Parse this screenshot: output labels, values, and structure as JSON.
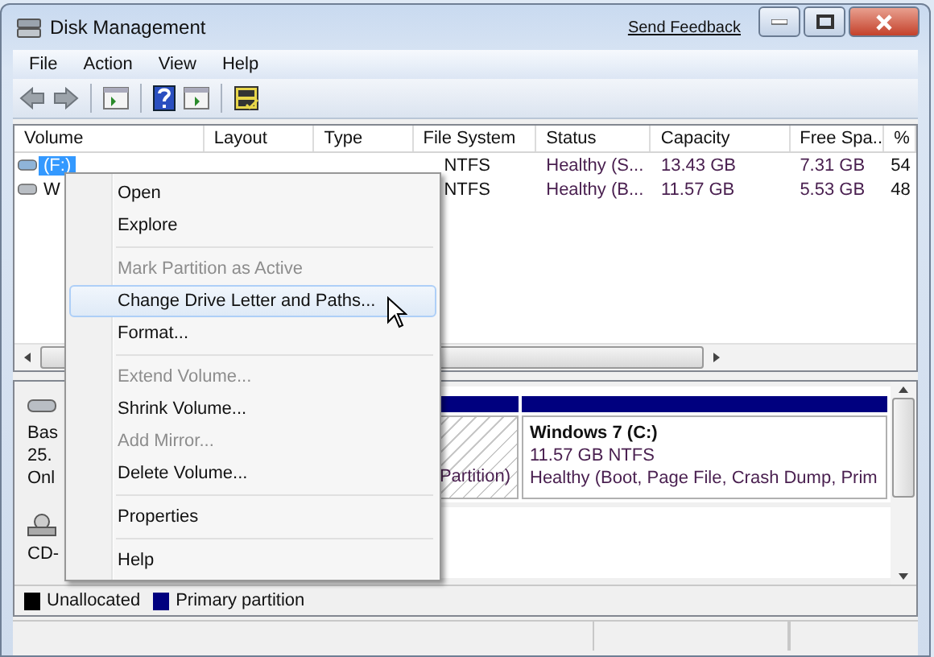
{
  "window": {
    "title": "Disk Management",
    "feedback_link": "Send Feedback"
  },
  "menu_bar": [
    "File",
    "Action",
    "View",
    "Help"
  ],
  "table": {
    "columns": [
      "Volume",
      "Layout",
      "Type",
      "File System",
      "Status",
      "Capacity",
      "Free Spa...",
      "%"
    ],
    "rows": [
      {
        "selected": true,
        "cells": [
          "(F:)",
          "",
          "",
          "NTFS",
          "Healthy (S...",
          "13.43 GB",
          "7.31 GB",
          "54"
        ]
      },
      {
        "selected": false,
        "cells": [
          "W",
          "",
          "",
          "NTFS",
          "Healthy (B...",
          "11.57 GB",
          "5.53 GB",
          "48"
        ]
      }
    ]
  },
  "disks": [
    {
      "kind": "disk",
      "label_lines": [
        "Bas",
        "25.",
        "Onl"
      ],
      "partitions": [
        {
          "kind": "hatched",
          "lines": [
            "Partition)"
          ]
        },
        {
          "kind": "primary",
          "lines": [
            "Windows 7  (C:)",
            "11.57 GB NTFS",
            "Healthy (Boot, Page File, Crash Dump, Prim"
          ]
        }
      ]
    },
    {
      "kind": "cdrom",
      "label_lines": [
        "CD-"
      ]
    }
  ],
  "legend": [
    {
      "label": "Unallocated",
      "color": "#000000"
    },
    {
      "label": "Primary partition",
      "color": "#00007f"
    }
  ],
  "context_menu": [
    {
      "kind": "item",
      "label": "Open",
      "disabled": false,
      "selected": false
    },
    {
      "kind": "item",
      "label": "Explore",
      "disabled": false,
      "selected": false
    },
    {
      "kind": "separator"
    },
    {
      "kind": "item",
      "label": "Mark Partition as Active",
      "disabled": true,
      "selected": false
    },
    {
      "kind": "item",
      "label": "Change Drive Letter and Paths...",
      "disabled": false,
      "selected": true
    },
    {
      "kind": "item",
      "label": "Format...",
      "disabled": false,
      "selected": false
    },
    {
      "kind": "separator"
    },
    {
      "kind": "item",
      "label": "Extend Volume...",
      "disabled": true,
      "selected": false
    },
    {
      "kind": "item",
      "label": "Shrink Volume...",
      "disabled": false,
      "selected": false
    },
    {
      "kind": "item",
      "label": "Add Mirror...",
      "disabled": true,
      "selected": false
    },
    {
      "kind": "item",
      "label": "Delete Volume...",
      "disabled": false,
      "selected": false
    },
    {
      "kind": "separator"
    },
    {
      "kind": "item",
      "label": "Properties",
      "disabled": false,
      "selected": false
    },
    {
      "kind": "separator"
    },
    {
      "kind": "item",
      "label": "Help",
      "disabled": false,
      "selected": false
    }
  ]
}
